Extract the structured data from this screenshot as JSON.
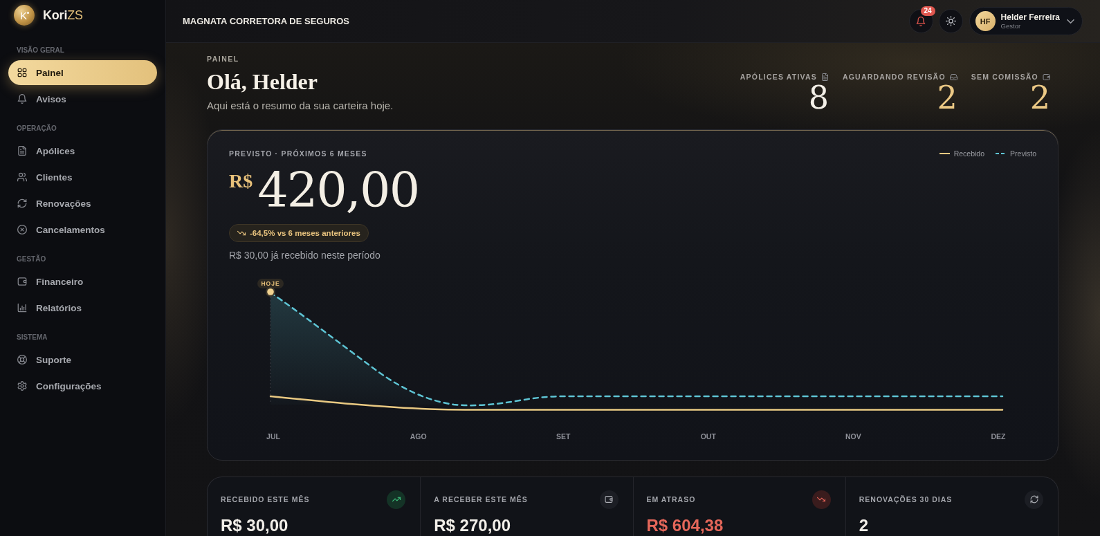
{
  "sidebar": {
    "brand": {
      "mark": "K",
      "name": "Kori",
      "accent": "ZS"
    },
    "sections": [
      {
        "title": "VISÃO GERAL",
        "items": [
          {
            "label": "Painel",
            "selected": true
          },
          {
            "label": "Avisos",
            "selected": false
          }
        ]
      },
      {
        "title": "OPERAÇÃO",
        "items": [
          {
            "label": "Apólices",
            "selected": false
          },
          {
            "label": "Clientes",
            "selected": false
          },
          {
            "label": "Renovações",
            "selected": false
          },
          {
            "label": "Cancelamentos",
            "selected": false
          }
        ]
      },
      {
        "title": "GESTÃO",
        "items": [
          {
            "label": "Financeiro",
            "selected": false
          },
          {
            "label": "Relatórios",
            "selected": false
          }
        ]
      },
      {
        "title": "SISTEMA",
        "items": [
          {
            "label": "Suporte",
            "selected": false
          },
          {
            "label": "Configurações",
            "selected": false
          }
        ]
      }
    ]
  },
  "header": {
    "company": "MAGNATA CORRETORA DE SEGUROS",
    "notification_count": "24",
    "user": {
      "initials": "HF",
      "name": "Helder Ferreira",
      "role": "Gestor"
    }
  },
  "hero": {
    "eyebrow": "PAINEL",
    "title": "Olá, Helder",
    "subtitle": "Aqui está o resumo da sua carteira hoje.",
    "stats": [
      {
        "label": "APÓLICES ATIVAS",
        "value": "8",
        "accent": false
      },
      {
        "label": "AGUARDANDO REVISÃO",
        "value": "2",
        "accent": true
      },
      {
        "label": "SEM COMISSÃO",
        "value": "2",
        "accent": true
      }
    ]
  },
  "forecast": {
    "title": "PREVISTO · PRÓXIMOS 6 MESES",
    "legend": [
      {
        "label": "Recebido",
        "color": "#e9c982",
        "kind": "solid"
      },
      {
        "label": "Previsto",
        "color": "#5ec4d4",
        "kind": "dashed"
      }
    ],
    "currency": "R$",
    "amount": "420,00",
    "change": {
      "text": "-64,5% vs 6 meses anteriores",
      "falling": true
    },
    "note": "R$ 30,00 já recebido neste período",
    "chart": {
      "marker": "HOJE",
      "x_labels": [
        "JUL",
        "AGO",
        "SET",
        "OUT",
        "NOV",
        "DEZ"
      ]
    }
  },
  "summary": [
    {
      "label": "RECEBIDO ESTE MÊS",
      "value": "R$ 30,00",
      "kind": "positive"
    },
    {
      "label": "A RECEBER ESTE MÊS",
      "value": "R$ 270,00",
      "kind": "neutral"
    },
    {
      "label": "EM ATRASO",
      "value": "R$ 604,38",
      "kind": "negative"
    },
    {
      "label": "RENOVAÇÕES 30 DIAS",
      "value": "2",
      "kind": "neutral"
    }
  ]
}
